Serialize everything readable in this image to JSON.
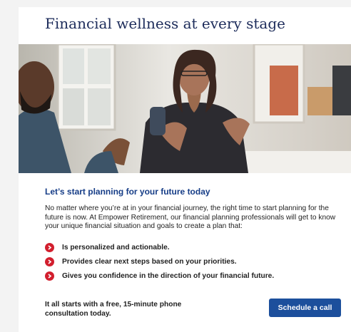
{
  "card": {
    "title": "Financial wellness at every stage",
    "subheading": "Let’s start planning for your future today",
    "body": "No matter where you’re at in your financial journey, the right time to start planning for the future is now. At Empower Retirement, our financial planning professionals will get to know your unique financial situation and goals to create a plan that:",
    "benefits": [
      {
        "label": "Is personalized and actionable.",
        "icon": "chevron-right-icon"
      },
      {
        "label": "Provides clear next steps based on your priorities.",
        "icon": "chevron-right-icon"
      },
      {
        "label": "Gives you confidence in the direction of your financial future.",
        "icon": "chevron-right-icon"
      }
    ],
    "cta_text": "It all starts with a free, 15-minute phone consultation today.",
    "cta_button": "Schedule a call"
  },
  "colors": {
    "title": "#1c2b5a",
    "subheading": "#163d87",
    "bullet": "#d21f2e",
    "button": "#1c4f9c"
  }
}
